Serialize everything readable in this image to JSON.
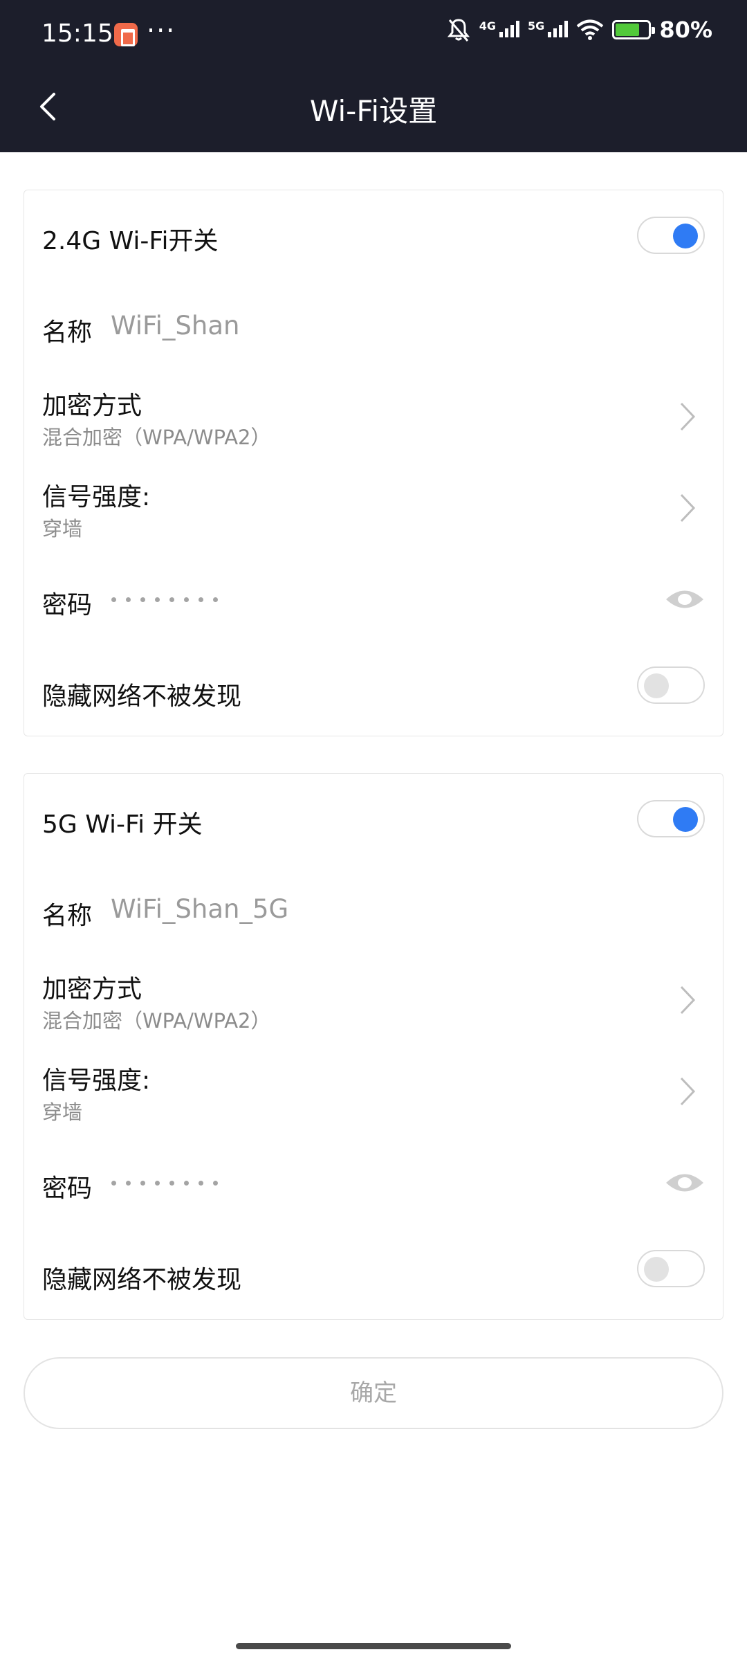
{
  "status_bar": {
    "time": "15:15",
    "net_4g": "4G",
    "net_5g": "5G",
    "battery": "80%"
  },
  "header": {
    "title": "Wi-Fi设置"
  },
  "wifi24": {
    "switch_label": "2.4G Wi-Fi开关",
    "switch_on": true,
    "name_label": "名称",
    "name_value": "WiFi_Shan",
    "encryption_label": "加密方式",
    "encryption_value": "混合加密（WPA/WPA2）",
    "signal_label": "信号强度:",
    "signal_value": "穿墙",
    "password_label": "密码",
    "hidden_label": "隐藏网络不被发现",
    "hidden_on": false
  },
  "wifi5": {
    "switch_label": "5G Wi-Fi 开关",
    "switch_on": true,
    "name_label": "名称",
    "name_value": "WiFi_Shan_5G",
    "encryption_label": "加密方式",
    "encryption_value": "混合加密（WPA/WPA2）",
    "signal_label": "信号强度:",
    "signal_value": "穿墙",
    "password_label": "密码",
    "hidden_label": "隐藏网络不被发现",
    "hidden_on": false
  },
  "confirm_label": "确定",
  "icons": [
    "back-arrow-icon",
    "chevron-right-icon",
    "eye-icon",
    "mute-icon",
    "wifi-icon",
    "battery-icon"
  ],
  "colors": {
    "header_bg": "#1c1e2b",
    "toggle_on": "#2f7bf4",
    "battery_fill": "#52c93a"
  }
}
